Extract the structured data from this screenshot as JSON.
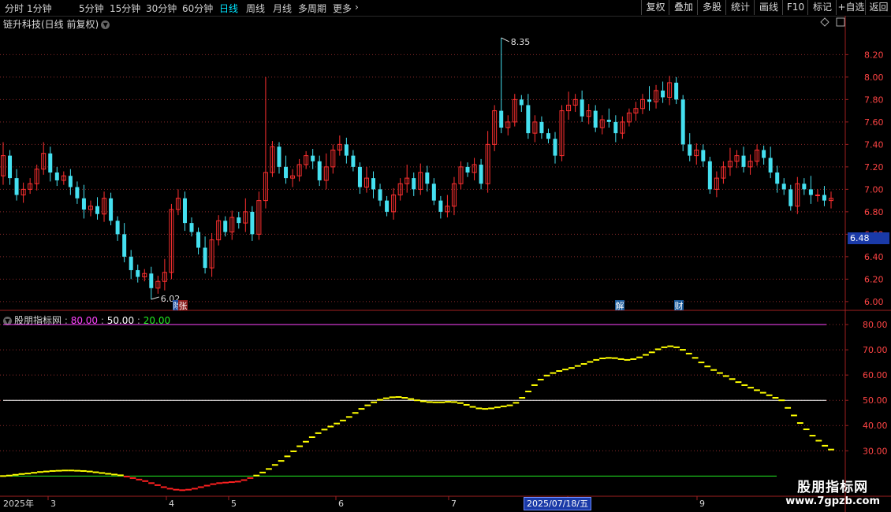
{
  "toolbar": {
    "periods": [
      {
        "label": "分时",
        "x": 6
      },
      {
        "label": "1分钟",
        "x": 34
      },
      {
        "label": "5分钟",
        "x": 100
      },
      {
        "label": "15分钟",
        "x": 139
      },
      {
        "label": "30分钟",
        "x": 185
      },
      {
        "label": "60分钟",
        "x": 231
      },
      {
        "label": "日线",
        "x": 278,
        "active": true
      },
      {
        "label": "周线",
        "x": 312
      },
      {
        "label": "月线",
        "x": 346
      },
      {
        "label": "多周期",
        "x": 378
      },
      {
        "label": "更多",
        "x": 422
      }
    ],
    "more_arrow": "›",
    "right_buttons": [
      "复权",
      "叠加",
      "多股",
      "统计",
      "画线",
      "F10",
      "标记",
      "+自选",
      "返回"
    ]
  },
  "stock": {
    "title": "链升科技(日线 前复权)",
    "current_price": "6.48",
    "high_label": "8.35",
    "low_label": "6.02"
  },
  "indicator": {
    "name": "股朋指标网",
    "levels": [
      {
        "text": "80.00",
        "color": "#ff44ff"
      },
      {
        "text": "50.00",
        "color": "#ffffff"
      },
      {
        "text": "20.00",
        "color": "#22ee22"
      }
    ]
  },
  "events": [
    {
      "label": "除",
      "bg": "#1a4aa0"
    },
    {
      "label": "张",
      "bg": "#8a1a1a"
    },
    {
      "label": "解",
      "bg": "#1a5a9a"
    },
    {
      "label": "财",
      "bg": "#1a5a9a"
    }
  ],
  "date_axis": {
    "year_label": "2025年",
    "months": [
      "3",
      "4",
      "5",
      "6",
      "7",
      "8",
      "9"
    ],
    "cursor_date": "2025/07/18/五"
  },
  "brand": {
    "name": "股朋指标网",
    "url": "www.7gpzb.com"
  },
  "colors": {
    "up": "#ff3030",
    "down": "#45e0f0",
    "osc_high": "#ffff00",
    "osc_low": "#ff2020",
    "grid": "#8a2a2a",
    "axis_text": "#ff4444"
  },
  "chart_data": [
    {
      "type": "candlestick",
      "title": "链升科技(日线 前复权)",
      "y_ticks": [
        6.0,
        6.2,
        6.4,
        6.6,
        6.8,
        7.0,
        7.2,
        7.4,
        7.6,
        7.8,
        8.0,
        8.2
      ],
      "ylim": [
        5.95,
        8.42
      ],
      "close": [
        7.3,
        7.1,
        6.95,
        7.0,
        7.05,
        7.18,
        7.32,
        7.15,
        7.08,
        7.12,
        7.02,
        6.92,
        6.82,
        6.85,
        6.78,
        6.92,
        6.72,
        6.6,
        6.4,
        6.28,
        6.22,
        6.25,
        6.12,
        6.18,
        6.26,
        6.82,
        6.92,
        6.7,
        6.62,
        6.48,
        6.3,
        6.55,
        6.72,
        6.62,
        6.75,
        6.7,
        6.8,
        6.6,
        6.9,
        7.15,
        7.38,
        7.2,
        7.1,
        7.12,
        7.22,
        7.3,
        7.25,
        7.08,
        7.2,
        7.35,
        7.4,
        7.3,
        7.2,
        7.02,
        7.1,
        7.0,
        6.9,
        6.8,
        6.95,
        7.05,
        7.1,
        7.0,
        7.15,
        7.05,
        6.9,
        6.8,
        6.85,
        7.05,
        7.2,
        7.15,
        7.22,
        7.05,
        7.4,
        7.7,
        7.55,
        7.6,
        7.8,
        7.75,
        7.5,
        7.6,
        7.5,
        7.45,
        7.3,
        7.7,
        7.75,
        7.8,
        7.65,
        7.7,
        7.55,
        7.62,
        7.6,
        7.5,
        7.6,
        7.68,
        7.72,
        7.8,
        7.78,
        7.88,
        7.82,
        7.95,
        7.8,
        7.4,
        7.3,
        7.35,
        7.25,
        7.0,
        7.1,
        7.2,
        7.25,
        7.3,
        7.2,
        7.25,
        7.35,
        7.28,
        7.15,
        7.05,
        7.0,
        6.85,
        7.05,
        7.0,
        6.95,
        6.95,
        6.9,
        6.92
      ],
      "open": [
        7.12,
        7.3,
        7.1,
        6.95,
        7.0,
        7.05,
        7.18,
        7.32,
        7.15,
        7.08,
        7.12,
        7.02,
        6.92,
        6.82,
        6.85,
        6.78,
        6.92,
        6.72,
        6.6,
        6.4,
        6.28,
        6.22,
        6.25,
        6.12,
        6.18,
        6.26,
        6.82,
        6.92,
        6.7,
        6.62,
        6.48,
        6.3,
        6.55,
        6.72,
        6.62,
        6.75,
        6.7,
        6.8,
        6.6,
        6.9,
        7.15,
        7.38,
        7.2,
        7.1,
        7.12,
        7.22,
        7.3,
        7.25,
        7.08,
        7.2,
        7.35,
        7.4,
        7.3,
        7.2,
        7.02,
        7.1,
        7.0,
        6.9,
        6.8,
        6.95,
        7.05,
        7.1,
        7.0,
        7.15,
        7.05,
        6.9,
        6.8,
        6.85,
        7.05,
        7.2,
        7.15,
        7.22,
        7.05,
        7.4,
        7.7,
        7.55,
        7.6,
        7.8,
        7.75,
        7.5,
        7.6,
        7.5,
        7.45,
        7.3,
        7.7,
        7.75,
        7.8,
        7.65,
        7.7,
        7.55,
        7.62,
        7.6,
        7.5,
        7.6,
        7.68,
        7.72,
        7.8,
        7.78,
        7.88,
        7.82,
        7.95,
        7.8,
        7.4,
        7.3,
        7.35,
        7.25,
        7.0,
        7.1,
        7.2,
        7.25,
        7.3,
        7.2,
        7.25,
        7.35,
        7.28,
        7.15,
        7.05,
        7.0,
        6.85,
        7.05,
        7.0,
        6.95,
        6.95,
        6.9
      ]
    },
    {
      "type": "line",
      "name": "股朋指标网",
      "y_ticks": [
        30,
        40,
        50,
        60,
        70,
        80
      ],
      "ylim": [
        12,
        85
      ],
      "ref_lines": [
        80,
        50,
        20
      ],
      "values": [
        20.0,
        20.2,
        20.5,
        20.8,
        21.0,
        21.3,
        21.6,
        21.8,
        22.0,
        22.1,
        22.2,
        22.2,
        22.1,
        22.0,
        21.8,
        21.5,
        21.2,
        20.9,
        20.6,
        20.3,
        19.8,
        19.2,
        18.6,
        18.0,
        17.2,
        16.4,
        15.6,
        15.0,
        14.6,
        14.4,
        14.6,
        15.0,
        15.6,
        16.2,
        16.8,
        17.2,
        17.4,
        17.6,
        17.8,
        18.4,
        19.2,
        20.2,
        21.4,
        22.8,
        24.4,
        26.0,
        27.8,
        29.8,
        31.8,
        33.6,
        35.4,
        37.0,
        38.4,
        39.6,
        40.8,
        42.0,
        43.4,
        45.0,
        46.6,
        48.0,
        49.2,
        50.2,
        50.8,
        51.2,
        51.3,
        51.0,
        50.5,
        50.0,
        49.6,
        49.3,
        49.2,
        49.2,
        49.4,
        49.3,
        48.9,
        48.2,
        47.4,
        46.8,
        46.6,
        46.8,
        47.2,
        47.6,
        48.0,
        49.0,
        51.0,
        53.5,
        56.0,
        58.2,
        59.8,
        60.8,
        61.6,
        62.2,
        62.8,
        63.6,
        64.4,
        65.2,
        66.0,
        66.6,
        66.8,
        66.7,
        66.3,
        66.0,
        66.3,
        67.0,
        68.0,
        69.0,
        70.2,
        71.0,
        71.4,
        71.0,
        70.0,
        68.5,
        66.8,
        65.0,
        63.4,
        62.0,
        60.8,
        59.6,
        58.4,
        57.2,
        56.0,
        55.0,
        54.0,
        53.0,
        52.0,
        51.0,
        50.0,
        47.0,
        44.0,
        41.0,
        38.5,
        36.0,
        34.0,
        32.0,
        30.5
      ]
    }
  ]
}
